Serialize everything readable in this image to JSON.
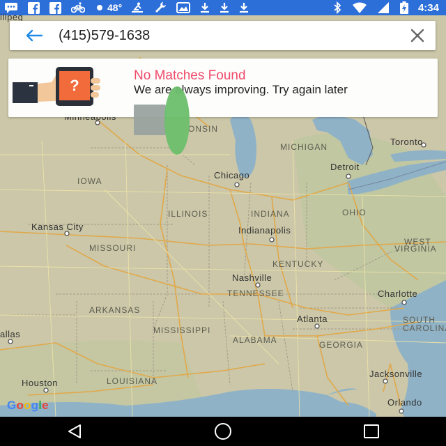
{
  "status_bar": {
    "background": "#2d6fd8",
    "temperature": "48°",
    "time": "4:34",
    "left_icons": [
      "message-icon",
      "facebook-icon",
      "facebook-icon",
      "bike-icon",
      "weather-icon",
      "rower-icon",
      "wrench-icon",
      "gallery-icon",
      "download-icon",
      "download-icon",
      "download-icon"
    ],
    "right_icons": [
      "bluetooth-icon",
      "wifi-icon",
      "signal-icon",
      "battery-charging-icon"
    ]
  },
  "search": {
    "value": "(415)579-1638",
    "accent_color": "#1e88e5"
  },
  "result_card": {
    "title": "No Matches Found",
    "message": "We are always improving. Try again later",
    "title_color": "#ef4a6a"
  },
  "map": {
    "labels": {
      "lipeg": "ilipeg",
      "minneapolis": "Minneapolis",
      "wisconsin": "ONSIN",
      "michigan": "MICHIGAN",
      "toronto": "Toronto",
      "iowa": "IOWA",
      "chicago": "Chicago",
      "detroit": "Detroit",
      "illinois": "ILLINOIS",
      "indiana": "INDIANA",
      "ohio": "OHIO",
      "kansas_city": "Kansas City",
      "indianapolis": "Indianapolis",
      "missouri": "MISSOURI",
      "west_virginia_1": "WEST",
      "west_virginia_2": "VIRGINIA",
      "kentucky": "KENTUCKY",
      "nashville": "Nashville",
      "tennessee": "TENNESSEE",
      "charlotte": "Charlotte",
      "arkansas": "ARKANSAS",
      "atlanta": "Atlanta",
      "south_carolina_1": "SOUTH",
      "south_carolina_2": "CAROLINA",
      "dallas": "allas",
      "mississippi": "MISSISSIPPI",
      "alabama": "ALABAMA",
      "georgia": "GEORGIA",
      "houston": "Houston",
      "louisiana": "LOUISIANA",
      "jacksonville": "Jacksonville",
      "orlando": "Orlando"
    },
    "google_logo": "Google"
  },
  "nav_bar": {
    "buttons": [
      "back-icon",
      "home-icon",
      "recents-icon"
    ]
  }
}
